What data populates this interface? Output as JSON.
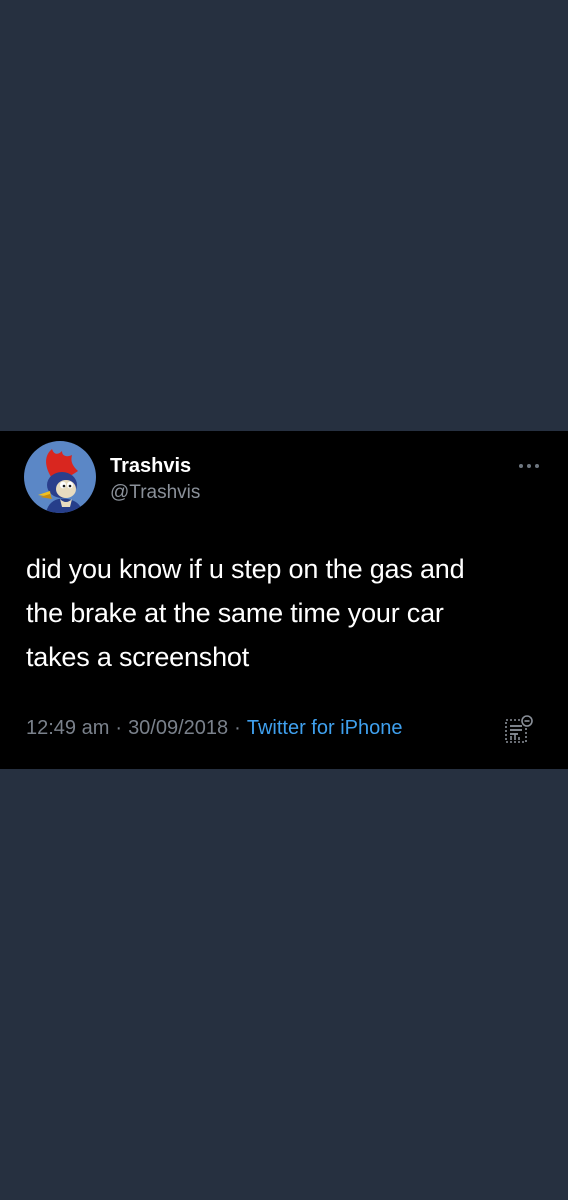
{
  "tweet": {
    "author": {
      "display_name": "Trashvis",
      "handle": "@Trashvis",
      "avatar_icon": "woody-woodpecker-avatar"
    },
    "text": "did you know if u step on the gas and\nthe brake at the same time your car\ntakes a screenshot",
    "time": "12:49 am",
    "date": "30/09/2018",
    "source": "Twitter for iPhone",
    "separator": "·",
    "icons": {
      "more": "more-options-icon",
      "analytics": "tweet-analytics-icon"
    }
  },
  "colors": {
    "page_background": "#263040",
    "card_background": "#000000",
    "primary_text": "#ffffff",
    "secondary_text": "#8a9099",
    "link": "#3fa0ee"
  }
}
